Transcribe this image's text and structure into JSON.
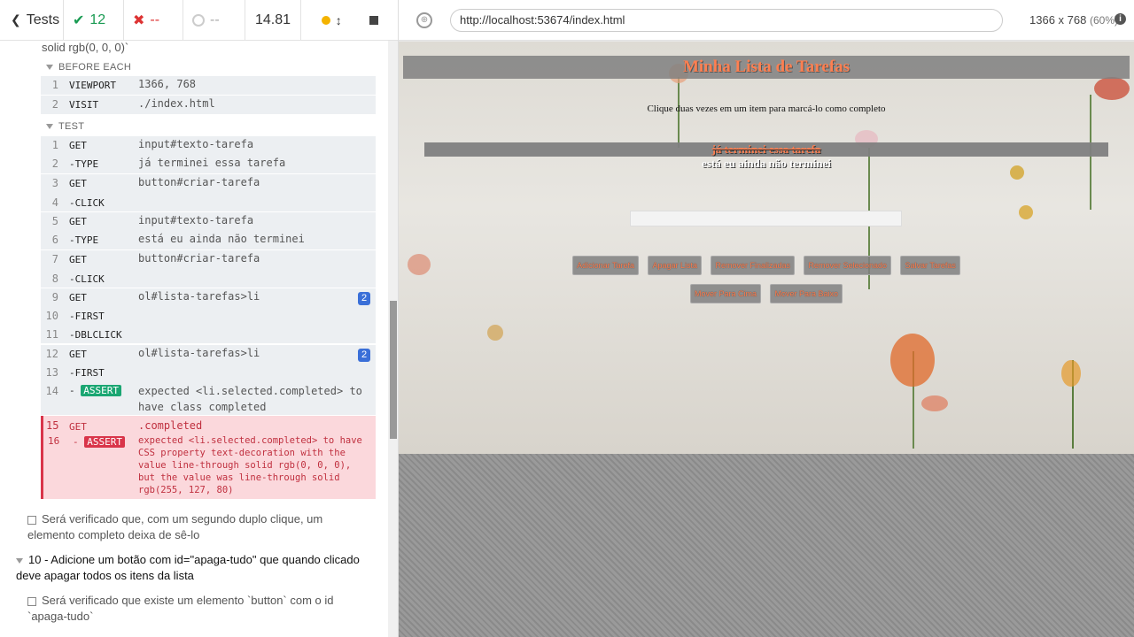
{
  "topbar": {
    "tests_label": "Tests",
    "passed": "12",
    "failed": "--",
    "pending": "--",
    "duration": "14.81"
  },
  "reporter": {
    "prev_tail": "solid rgb(0, 0, 0)`",
    "before_each_label": "BEFORE EACH",
    "before_each": [
      {
        "n": "1",
        "cmd": "VIEWPORT",
        "msg": "1366, 768"
      },
      {
        "n": "2",
        "cmd": "VISIT",
        "msg": "./index.html"
      }
    ],
    "test_label": "TEST",
    "commands": [
      {
        "n": "1",
        "cmd": "GET",
        "msg": "input#texto-tarefa"
      },
      {
        "n": "2",
        "cmd": "-TYPE",
        "msg": "já terminei essa tarefa"
      },
      {
        "n": "3",
        "cmd": "GET",
        "msg": "button#criar-tarefa"
      },
      {
        "n": "4",
        "cmd": "-CLICK",
        "msg": ""
      },
      {
        "n": "5",
        "cmd": "GET",
        "msg": "input#texto-tarefa"
      },
      {
        "n": "6",
        "cmd": "-TYPE",
        "msg": "está eu ainda não terminei"
      },
      {
        "n": "7",
        "cmd": "GET",
        "msg": "button#criar-tarefa"
      },
      {
        "n": "8",
        "cmd": "-CLICK",
        "msg": ""
      },
      {
        "n": "9",
        "cmd": "GET",
        "msg": "ol#lista-tarefas>li"
      },
      {
        "n": "10",
        "cmd": "-FIRST",
        "msg": ""
      },
      {
        "n": "11",
        "cmd": "-DBLCLICK",
        "msg": ""
      },
      {
        "n": "12",
        "cmd": "GET",
        "msg": "ol#lista-tarefas>li"
      },
      {
        "n": "13",
        "cmd": "-FIRST",
        "msg": ""
      }
    ],
    "badge_9": "2",
    "badge_12": "2",
    "assert_14": {
      "n": "14",
      "label": "ASSERT",
      "text1": "expected",
      "subject": "<li.selected.completed>",
      "text2": "to have class",
      "value": "completed"
    },
    "fail_15": {
      "n": "15",
      "cmd": "GET",
      "msg": ".completed"
    },
    "fail_16": {
      "n": "16",
      "label": "ASSERT",
      "line1": "expected <li.selected.completed> to have",
      "line2": "CSS property text-decoration with the",
      "line3": "value line-through solid rgb(0, 0, 0),",
      "line4": "but the value was line-through solid",
      "line5": "rgb(255, 127, 80)"
    },
    "test_next": "Será verificado que, com um segundo duplo clique, um elemento completo deixa de sê-lo",
    "section_10": "10 - Adicione um botão com id=\"apaga-tudo\" que quando clicado deve apagar todos os itens da lista",
    "test_last": "Será verificado que existe um elemento `button` com o id `apaga-tudo`"
  },
  "browser": {
    "url": "http://localhost:53674/index.html",
    "viewport": "1366 x 768",
    "scale": "(60%)"
  },
  "aut": {
    "title": "Minha Lista de Tarefas",
    "instructions": "Clique duas vezes em um item para marcá-lo como completo",
    "items": [
      "já terminei essa tarefa",
      "está eu ainda não terminei"
    ],
    "buttons_row1": [
      "Adicionar Tarefa",
      "Apagar Lista",
      "Remover Finalizadas",
      "Remover Selecionado",
      "Salvar Tarefas"
    ],
    "buttons_row2": [
      "Mover Para Cima",
      "Mover Para Baixo"
    ]
  },
  "colors": {
    "pass": "#1a9b53",
    "fail": "#d9354a",
    "accent": "#ff7f50",
    "badge": "#3a6fd8"
  }
}
